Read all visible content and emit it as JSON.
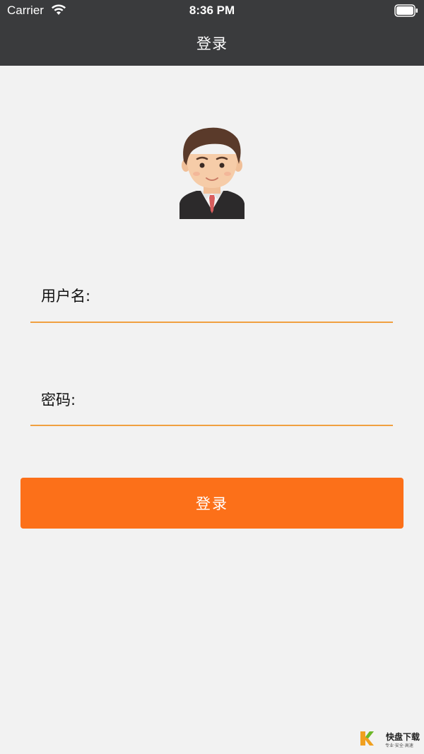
{
  "status_bar": {
    "carrier": "Carrier",
    "time": "8:36 PM"
  },
  "nav": {
    "title": "登录"
  },
  "form": {
    "username_label": "用户名:",
    "username_value": "",
    "password_label": "密码:",
    "password_value": "",
    "submit_label": "登录"
  },
  "colors": {
    "nav_bg": "#3a3b3d",
    "page_bg": "#f2f2f2",
    "accent": "#fc7019",
    "underline": "#f0a040"
  },
  "watermark": {
    "brand": "快盘下载",
    "tagline": "专业·安全·高速"
  }
}
